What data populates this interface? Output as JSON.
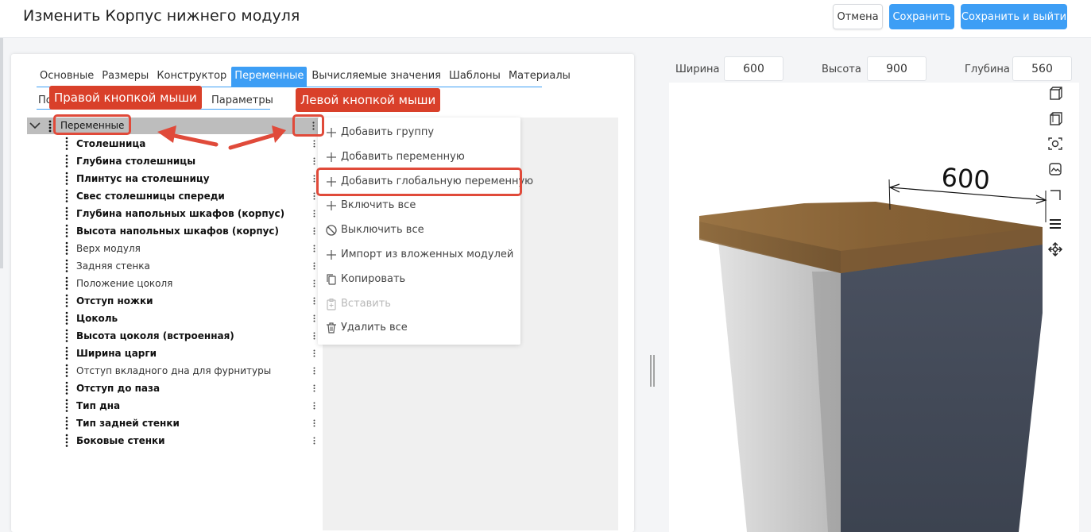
{
  "header": {
    "title": "Изменить Корпус нижнего модуля",
    "cancel_label": "Отмена",
    "save_label": "Сохранить",
    "save_exit_label": "Сохранить и выйти"
  },
  "tabs": [
    "Основные",
    "Размеры",
    "Конструктор",
    "Переменные",
    "Вычисляемые значения",
    "Шаблоны",
    "Материалы"
  ],
  "subtabs": {
    "first_partial": "По",
    "second": "Параметры"
  },
  "tree": {
    "root_label": "Переменные",
    "items": [
      {
        "label": "Столешница",
        "bold": true
      },
      {
        "label": "Глубина столешницы",
        "bold": true
      },
      {
        "label": "Плинтус на столешницу",
        "bold": true
      },
      {
        "label": "Свес столешницы спереди",
        "bold": true
      },
      {
        "label": "Глубина напольных шкафов (корпус)",
        "bold": true
      },
      {
        "label": "Высота напольных шкафов (корпус)",
        "bold": true
      },
      {
        "label": "Верх модуля",
        "bold": false
      },
      {
        "label": "Задняя стенка",
        "bold": false
      },
      {
        "label": "Положение цоколя",
        "bold": false
      },
      {
        "label": "Отступ ножки",
        "bold": true
      },
      {
        "label": "Цоколь",
        "bold": true
      },
      {
        "label": "Высота цоколя (встроенная)",
        "bold": true
      },
      {
        "label": "Ширина царги",
        "bold": true
      },
      {
        "label": "Отступ вкладного дна для фурнитуры",
        "bold": false
      },
      {
        "label": "Отступ до паза",
        "bold": true
      },
      {
        "label": "Тип дна",
        "bold": true
      },
      {
        "label": "Тип задней стенки",
        "bold": true
      },
      {
        "label": "Боковые стенки",
        "bold": true
      }
    ]
  },
  "context_menu": {
    "items": [
      {
        "label": "Добавить группу",
        "icon": "plus-icon",
        "disabled": false
      },
      {
        "label": "Добавить переменную",
        "icon": "plus-icon",
        "disabled": false
      },
      {
        "label": "Добавить глобальную переменную",
        "icon": "plus-icon",
        "disabled": false
      },
      {
        "label": "Включить все",
        "icon": "plus-icon",
        "disabled": false
      },
      {
        "label": "Выключить все",
        "icon": "ban-icon",
        "disabled": false
      },
      {
        "label": "Импорт из вложенных модулей",
        "icon": "plus-icon",
        "disabled": false
      },
      {
        "label": "Копировать",
        "icon": "copy-icon",
        "disabled": false
      },
      {
        "label": "Вставить",
        "icon": "paste-icon",
        "disabled": true
      },
      {
        "label": "Удалить все",
        "icon": "trash-icon",
        "disabled": false
      }
    ]
  },
  "annotations": {
    "right_click": "Правой кнопкой мыши",
    "left_click": "Левой кнопкой мыши"
  },
  "dimensions": {
    "width_label": "Ширина",
    "width_value": "600",
    "height_label": "Высота",
    "height_value": "900",
    "depth_label": "Глубина",
    "depth_value": "560"
  },
  "viewport": {
    "dimension_text": "600",
    "icons": [
      "cube-front-icon",
      "cube-back-icon",
      "camera-icon",
      "image-icon",
      "cube-edge-icon",
      "menu-icon",
      "move-icon"
    ]
  },
  "colors": {
    "accent": "#3d9ef5",
    "annotation_red": "#d9402a",
    "countertop": "#8a6438",
    "cabinet_side": "#454c5a"
  }
}
